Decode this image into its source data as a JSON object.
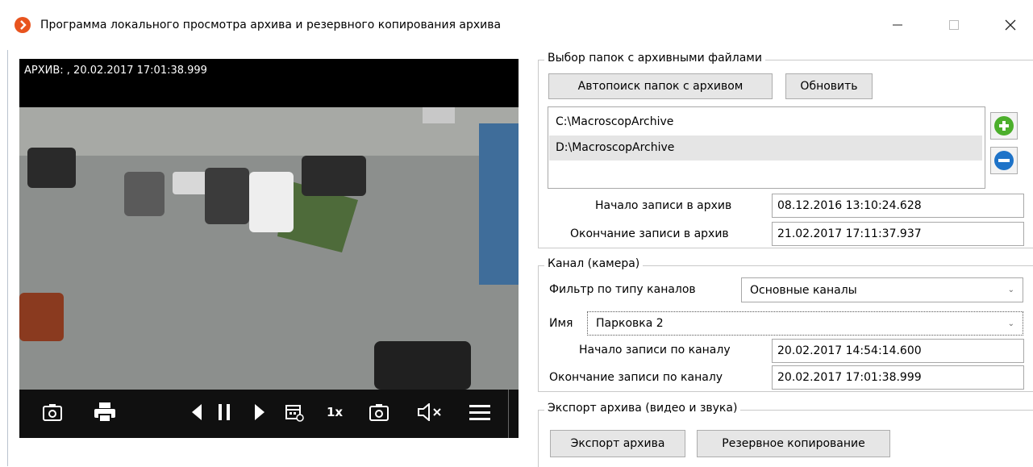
{
  "window": {
    "title": "Программа локального просмотра архива и резервного копирования архива",
    "minimize_icon": "minimize-icon",
    "maximize_icon": "maximize-icon",
    "close_icon": "close-icon"
  },
  "video": {
    "overlay": "АРХИВ: , 20.02.2017 17:01:38.999",
    "speed": "1x",
    "icons": [
      "snapshot-icon",
      "print-icon",
      "step-back-icon",
      "pause-icon",
      "step-forward-icon",
      "calendar-icon",
      "snapshot-icon",
      "mute-icon",
      "menu-icon"
    ]
  },
  "folders": {
    "legend": "Выбор папок с архивными файлами",
    "autosearch_label": "Автопоиск папок с архивом",
    "refresh_label": "Обновить",
    "items": [
      "C:\\MacroscopArchive",
      "D:\\MacroscopArchive"
    ],
    "start_label": "Начало записи в архив",
    "start_value": "08.12.2016 13:10:24.628",
    "end_label": "Окончание записи в архив",
    "end_value": "21.02.2017 17:11:37.937"
  },
  "channel": {
    "legend": "Канал (камера)",
    "filter_label": "Фильтр по типу каналов",
    "filter_value": "Основные каналы",
    "name_label": "Имя",
    "name_value": "Парковка 2",
    "start_label": "Начало записи по каналу",
    "start_value": "20.02.2017 14:54:14.600",
    "end_label": "Окончание записи по каналу",
    "end_value": "20.02.2017 17:01:38.999"
  },
  "export": {
    "legend": "Экспорт архива (видео и звука)",
    "export_label": "Экспорт архива",
    "backup_label": "Резервное копирование"
  },
  "colors": {
    "accent_orange": "#e8541e",
    "add_green": "#4caf2c",
    "remove_blue": "#1e73c8"
  }
}
